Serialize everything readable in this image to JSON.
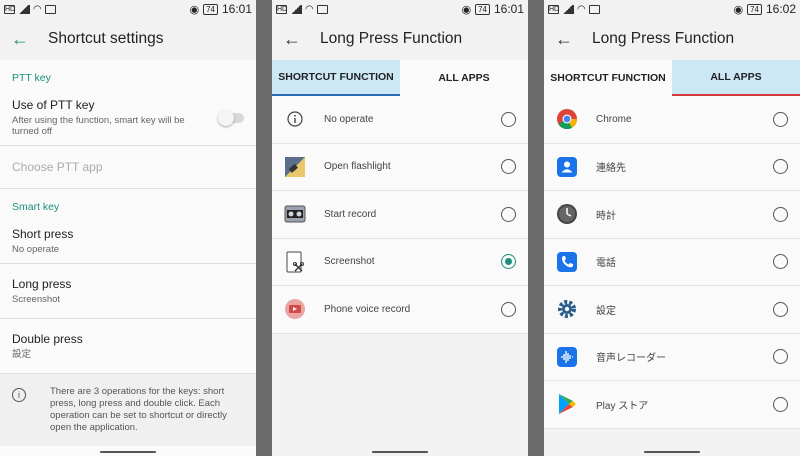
{
  "status": {
    "p1_time": "16:01",
    "p2_time": "16:01",
    "p3_time": "16:02",
    "battery": "74"
  },
  "panel1": {
    "title": "Shortcut settings",
    "ptt_header": "PTT key",
    "use_ptt_title": "Use of PTT key",
    "use_ptt_sub": "After using the function, smart key will be turned off",
    "choose_ptt": "Choose PTT app",
    "smart_header": "Smart key",
    "short_title": "Short press",
    "short_sub": "No operate",
    "long_title": "Long press",
    "long_sub": "Screenshot",
    "double_title": "Double press",
    "double_sub": "設定",
    "info": "There are 3 operations for the keys: short press, long press and double click. Each operation can be set to shortcut or directly open the application."
  },
  "panel2": {
    "title": "Long Press Function",
    "tab1": "SHORTCUT FUNCTION",
    "tab2": "ALL APPS",
    "items": [
      {
        "label": "No operate",
        "icon": "info-icon",
        "selected": false
      },
      {
        "label": "Open flashlight",
        "icon": "flashlight-icon",
        "selected": false
      },
      {
        "label": "Start record",
        "icon": "record-icon",
        "selected": false
      },
      {
        "label": "Screenshot",
        "icon": "screenshot-icon",
        "selected": true
      },
      {
        "label": "Phone voice record",
        "icon": "phone-voice-record-icon",
        "selected": false
      }
    ]
  },
  "panel3": {
    "title": "Long Press Function",
    "tab1": "SHORTCUT FUNCTION",
    "tab2": "ALL APPS",
    "items": [
      {
        "label": "Chrome",
        "icon": "chrome-icon"
      },
      {
        "label": "連絡先",
        "icon": "contacts-icon"
      },
      {
        "label": "時計",
        "icon": "clock-icon"
      },
      {
        "label": "電話",
        "icon": "phone-icon"
      },
      {
        "label": "設定",
        "icon": "settings-gear-icon"
      },
      {
        "label": "音声レコーダー",
        "icon": "voice-recorder-icon"
      },
      {
        "label": "Play ストア",
        "icon": "play-store-icon"
      }
    ]
  },
  "colors": {
    "accent": "#1a8f7c",
    "tab_active_bg": "#cde8f5",
    "tab_line_blue": "#2a6fb5",
    "tab_line_red": "#d23a3a"
  }
}
